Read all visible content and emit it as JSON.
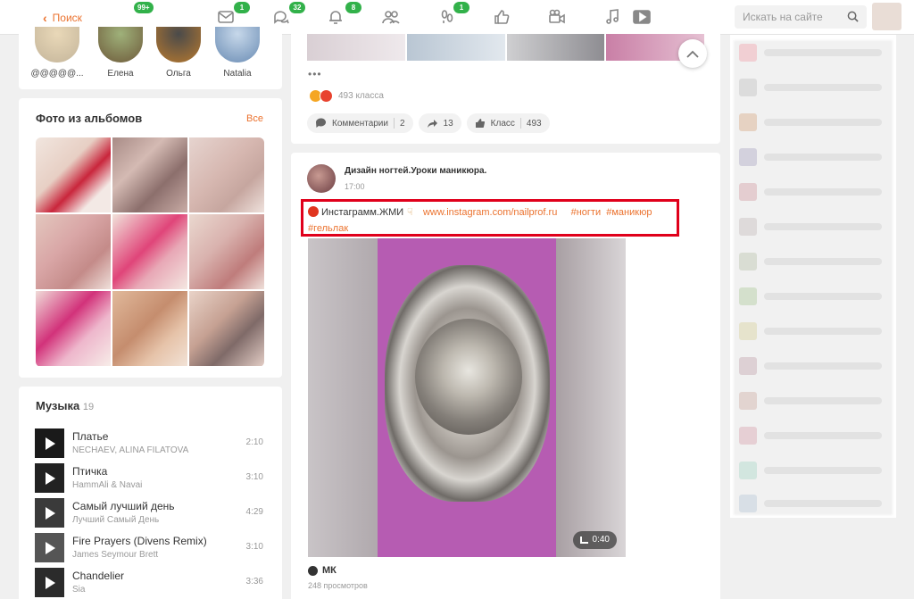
{
  "topbar": {
    "back_label": "Поиск",
    "badges": {
      "profile": "99+",
      "messages": "1",
      "discussions": "32",
      "notifications": "8",
      "guests": "1"
    },
    "search_placeholder": "Искать на сайте"
  },
  "friends": [
    {
      "name": "@@@@@..."
    },
    {
      "name": "Елена"
    },
    {
      "name": "Ольга"
    },
    {
      "name": "Natalia"
    }
  ],
  "albums": {
    "title": "Фото из альбомов",
    "all_label": "Все"
  },
  "music": {
    "title": "Музыка",
    "count": "19",
    "tracks": [
      {
        "title": "Платье",
        "artist": "NECHAEV, ALINA FILATOVA",
        "duration": "2:10"
      },
      {
        "title": "Птичка",
        "artist": "HammAli & Navai",
        "duration": "3:10"
      },
      {
        "title": "Самый лучший день",
        "artist": "Лучший Самый День",
        "duration": "4:29"
      },
      {
        "title": "Fire Prayers (Divens Remix)",
        "artist": "James Seymour Brett",
        "duration": "3:10"
      },
      {
        "title": "Chandelier",
        "artist": "Sia",
        "duration": "3:36"
      }
    ]
  },
  "feed_prev": {
    "dots": "•••",
    "reactions_count": "493 класса",
    "comments_label": "Комментарии",
    "comments_count": "2",
    "shares_count": "13",
    "likes_label": "Класс",
    "likes_count": "493"
  },
  "post": {
    "group_name": "Дизайн ногтей.Уроки маникюра.",
    "time": "17:00",
    "text_prefix": "Инстаграмм.ЖМИ",
    "link": "www.instagram.com/nailprof.ru",
    "tag1": "#ногти",
    "tag2": "#маникюр",
    "tag3": "#гельлак",
    "video_duration": "0:40",
    "author": "МК",
    "views": "248 просмотров"
  },
  "colors": {
    "accent": "#eb722e",
    "badge": "#32b14a",
    "highlight": "#e0001b"
  }
}
